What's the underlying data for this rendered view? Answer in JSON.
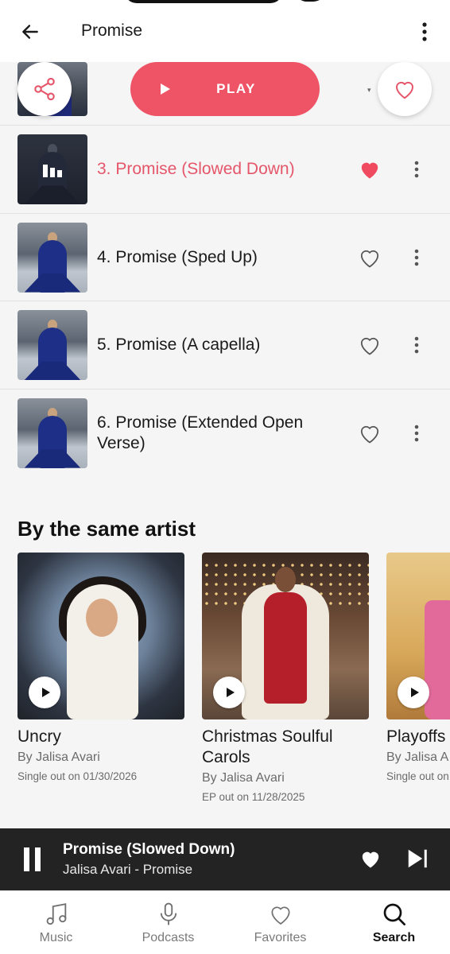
{
  "header": {
    "title": "Promise",
    "back_icon": "arrow-left-icon",
    "more_icon": "vertical-dots-icon"
  },
  "actions": {
    "play_label": "PLAY",
    "share_icon": "share-icon",
    "favorite_icon": "heart-outline-icon"
  },
  "colors": {
    "accent": "#ef5466",
    "playing_text": "#e5566a",
    "player_bg": "#232323"
  },
  "tracks": [
    {
      "title": "3. Promise (Slowed Down)",
      "playing": true,
      "liked": true
    },
    {
      "title": "4. Promise (Sped Up)",
      "playing": false,
      "liked": false
    },
    {
      "title": "5. Promise (A capella)",
      "playing": false,
      "liked": false
    },
    {
      "title": "6. Promise (Extended Open Verse)",
      "playing": false,
      "liked": false
    }
  ],
  "same_artist": {
    "heading": "By the same artist",
    "items": [
      {
        "title": "Uncry",
        "by": "By Jalisa Avari",
        "date": "Single out on 01/30/2026"
      },
      {
        "title": "Christmas Soulful Carols",
        "by": "By Jalisa Avari",
        "date": "EP out on 11/28/2025"
      },
      {
        "title": "Playoffs",
        "by": "By Jalisa A",
        "date": "Single out on"
      }
    ]
  },
  "now_playing": {
    "title": "Promise (Slowed Down)",
    "subtitle": "Jalisa Avari - Promise",
    "liked": true
  },
  "tabs": [
    {
      "label": "Music",
      "icon": "music-note-icon",
      "active": false
    },
    {
      "label": "Podcasts",
      "icon": "microphone-icon",
      "active": false
    },
    {
      "label": "Favorites",
      "icon": "heart-outline-icon",
      "active": false
    },
    {
      "label": "Search",
      "icon": "search-icon",
      "active": true
    }
  ]
}
